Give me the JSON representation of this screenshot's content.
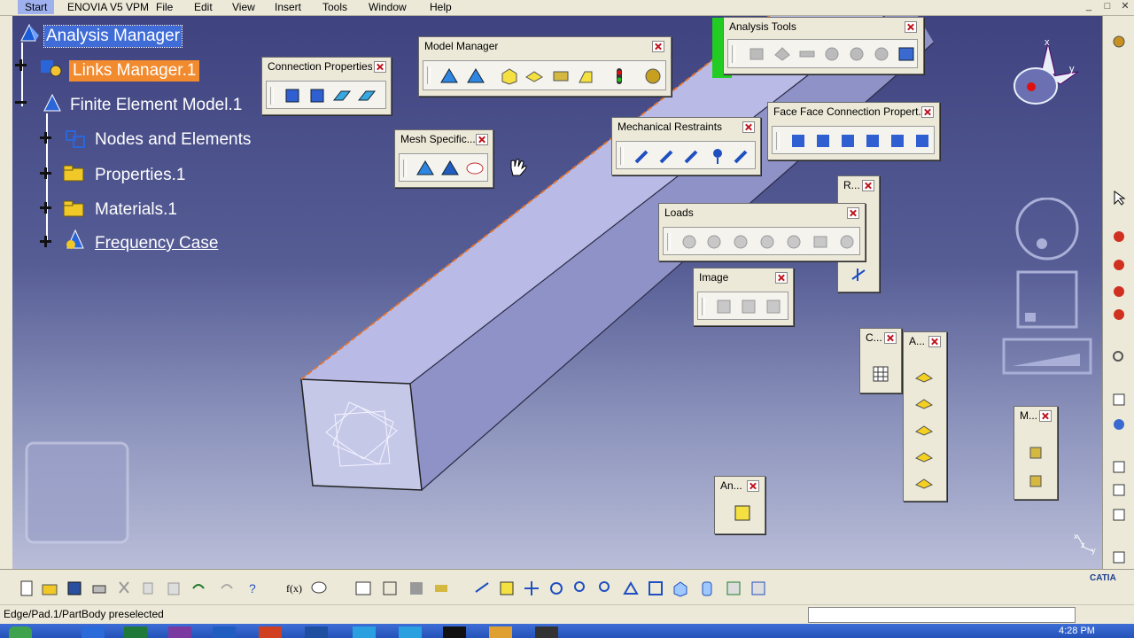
{
  "menubar": {
    "items": [
      "Start",
      "ENOVIA V5 VPM",
      "File",
      "Edit",
      "View",
      "Insert",
      "Tools",
      "Window",
      "Help"
    ]
  },
  "tree": {
    "root": "Analysis Manager",
    "links": "Links Manager.1",
    "fem": "Finite Element Model.1",
    "nodes": "Nodes and Elements",
    "properties": "Properties.1",
    "materials": "Materials.1",
    "case": "Frequency Case"
  },
  "toolbars": {
    "analysis_tools": "Analysis Tools",
    "model_manager": "Model Manager",
    "connection_properties": "Connection Properties",
    "mesh_specific": "Mesh Specific...",
    "mechanical_restraints": "Mechanical Restraints",
    "face_face": "Face Face Connection Propert...",
    "r_short": "R...",
    "loads": "Loads",
    "image": "Image",
    "c_short": "C...",
    "a_short": "A...",
    "m_short": "M...",
    "an_short": "An..."
  },
  "compass": {
    "x": "x",
    "y": "y"
  },
  "axis_small": {
    "x": "x",
    "z": "z",
    "y": "y"
  },
  "status": {
    "text": "Edge/Pad.1/PartBody preselected"
  },
  "taskbar": {
    "clock": "4:28 PM"
  },
  "brand": {
    "logo": "CATIA"
  },
  "colors": {
    "selection": "#3f6cd6",
    "links_highlight": "#f28a2e",
    "viewport_top": "#3f4380",
    "viewport_bottom": "#b9bdd8",
    "toolbar_bg": "#ece9d8"
  }
}
